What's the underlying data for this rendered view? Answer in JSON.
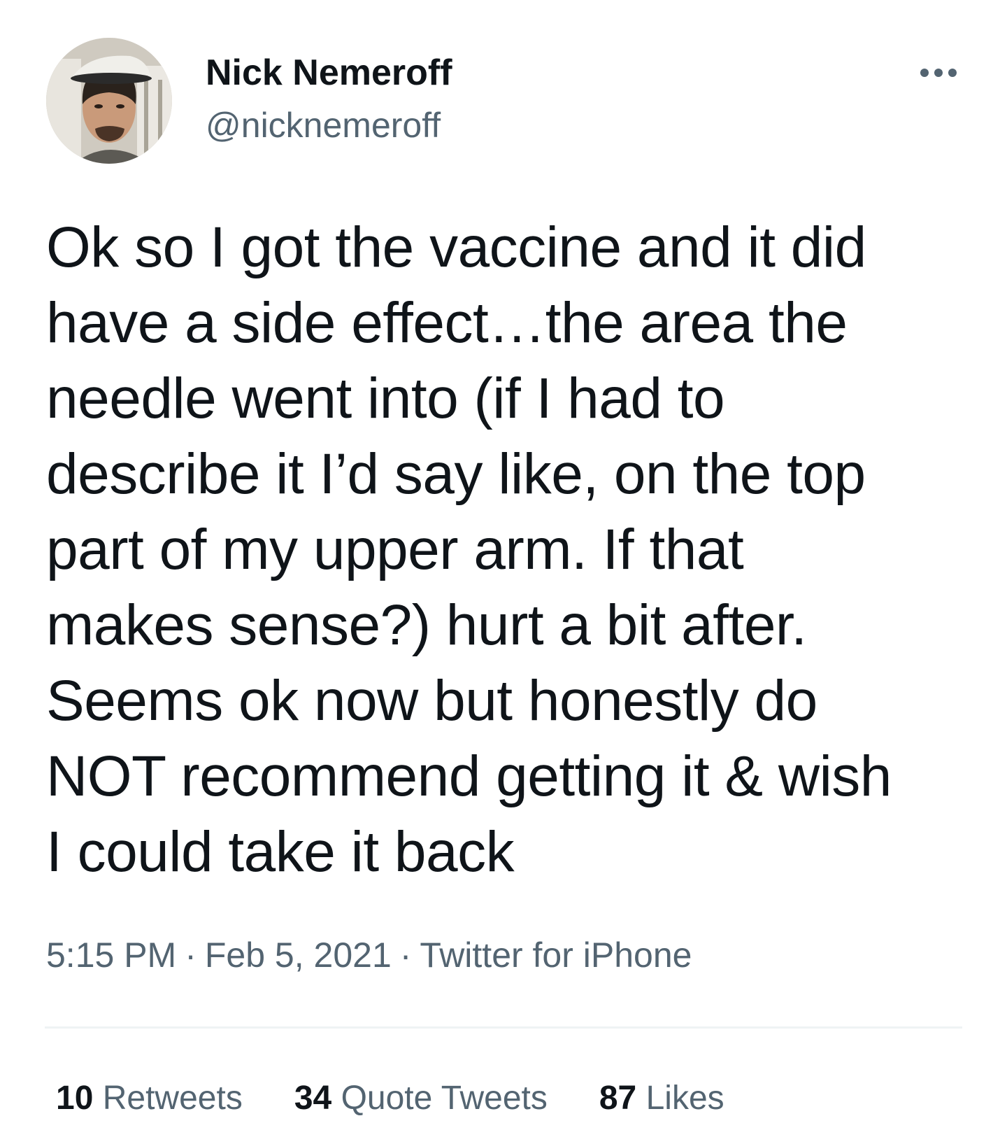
{
  "author": {
    "name": "Nick Nemeroff",
    "handle": "@nicknemeroff",
    "avatar_icon": "profile-photo"
  },
  "more_icon": "more-horizontal-icon",
  "tweet": {
    "text": "Ok so I got the vaccine and it did\nhave a side effect…the area the\nneedle went into (if I had to\ndescribe it I’d say like, on the top\npart of my upper arm. If that\nmakes sense?) hurt a bit after.\nSeems ok now but honestly do\nNOT recommend getting it & wish\nI could take it back"
  },
  "meta": {
    "time": "5:15 PM",
    "separator": "·",
    "date": "Feb 5, 2021",
    "source": "Twitter for iPhone"
  },
  "stats": {
    "retweets": {
      "count": "10",
      "label": "Retweets"
    },
    "quote_tweets": {
      "count": "34",
      "label": "Quote Tweets"
    },
    "likes": {
      "count": "87",
      "label": "Likes"
    }
  },
  "colors": {
    "primary_text": "#0f1419",
    "secondary_text": "#536471",
    "divider": "#eff3f4"
  }
}
